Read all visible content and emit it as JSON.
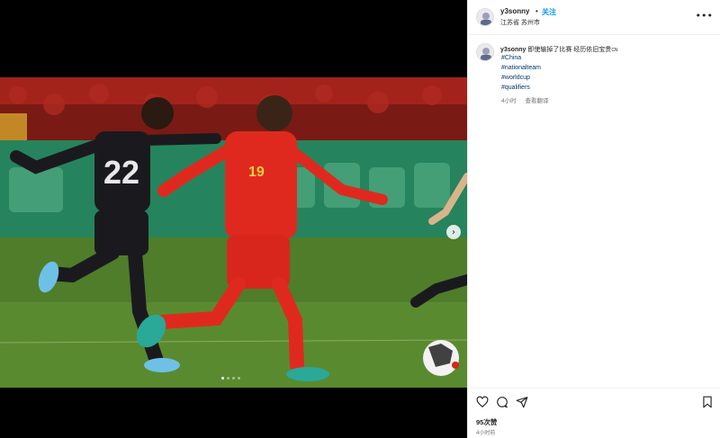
{
  "post": {
    "username": "y3sonny",
    "separator": "•",
    "follow_label": "关注",
    "location": "江苏省 苏州市",
    "more_icon": "more-horizontal-icon",
    "caption_text": "即使输掉了比赛 经历依旧宝贵",
    "caption_flag": "CN",
    "hashtags": [
      "#China",
      "#nationalteam",
      "#worldcup",
      "#qualifiers"
    ],
    "caption_time": "4小时",
    "reply_label": "查看翻译",
    "likes": "95次赞",
    "post_time": "4小时前"
  },
  "media": {
    "photo_alt": "Football match photo",
    "slide_count": 4,
    "active_slide": 0,
    "next_icon": "chevron-right-icon"
  },
  "colors": {
    "accent": "#0095f6",
    "hashtag": "#00376b",
    "text": "#262626",
    "muted": "#737373"
  }
}
